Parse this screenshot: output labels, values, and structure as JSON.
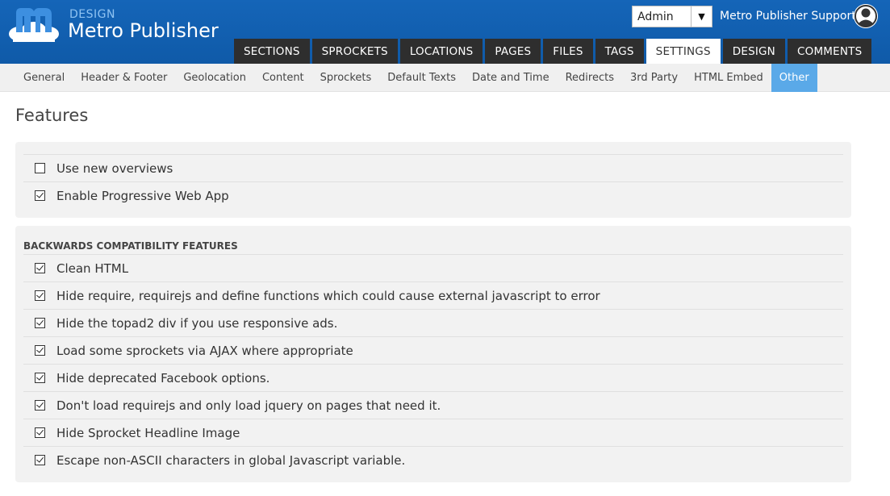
{
  "brand": {
    "sub": "DESIGN",
    "title": "Metro Publisher"
  },
  "role_select": {
    "value": "Admin"
  },
  "user": {
    "name": "Metro Publisher Support"
  },
  "main_tabs": [
    {
      "label": "SECTIONS"
    },
    {
      "label": "SPROCKETS"
    },
    {
      "label": "LOCATIONS"
    },
    {
      "label": "PAGES"
    },
    {
      "label": "FILES"
    },
    {
      "label": "TAGS"
    },
    {
      "label": "SETTINGS",
      "active": true
    },
    {
      "label": "DESIGN"
    },
    {
      "label": "COMMENTS"
    }
  ],
  "sub_tabs": [
    {
      "label": "General"
    },
    {
      "label": "Header & Footer"
    },
    {
      "label": "Geolocation"
    },
    {
      "label": "Content"
    },
    {
      "label": "Sprockets"
    },
    {
      "label": "Default Texts"
    },
    {
      "label": "Date and Time"
    },
    {
      "label": "Redirects"
    },
    {
      "label": "3rd Party"
    },
    {
      "label": "HTML Embed"
    },
    {
      "label": "Other",
      "active": true
    }
  ],
  "page_title": "Features",
  "features": [
    {
      "label": "Use new overviews",
      "checked": false
    },
    {
      "label": "Enable Progressive Web App",
      "checked": true
    }
  ],
  "compat": {
    "heading": "BACKWARDS COMPATIBILITY FEATURES",
    "items": [
      {
        "label": "Clean HTML",
        "checked": true
      },
      {
        "label": "Hide require, requirejs and define functions which could cause external javascript to error",
        "checked": true
      },
      {
        "label": "Hide the topad2 div if you use responsive ads.",
        "checked": true
      },
      {
        "label": "Load some sprockets via AJAX where appropriate",
        "checked": true
      },
      {
        "label": "Hide deprecated Facebook options.",
        "checked": true
      },
      {
        "label": "Don't load requirejs and only load jquery on pages that need it.",
        "checked": true
      },
      {
        "label": "Hide Sprocket Headline Image",
        "checked": true
      },
      {
        "label": "Escape non-ASCII characters in global Javascript variable.",
        "checked": true
      }
    ]
  },
  "colors": {
    "header": "#1565b8",
    "tab_dark": "#2e2e2e",
    "subnav_active": "#5aa9e8",
    "panel_bg": "#f2f2f2"
  },
  "icons": {
    "logo": "metro-publisher-logo",
    "avatar": "user-avatar-icon",
    "dropdown": "chevron-down-icon"
  }
}
